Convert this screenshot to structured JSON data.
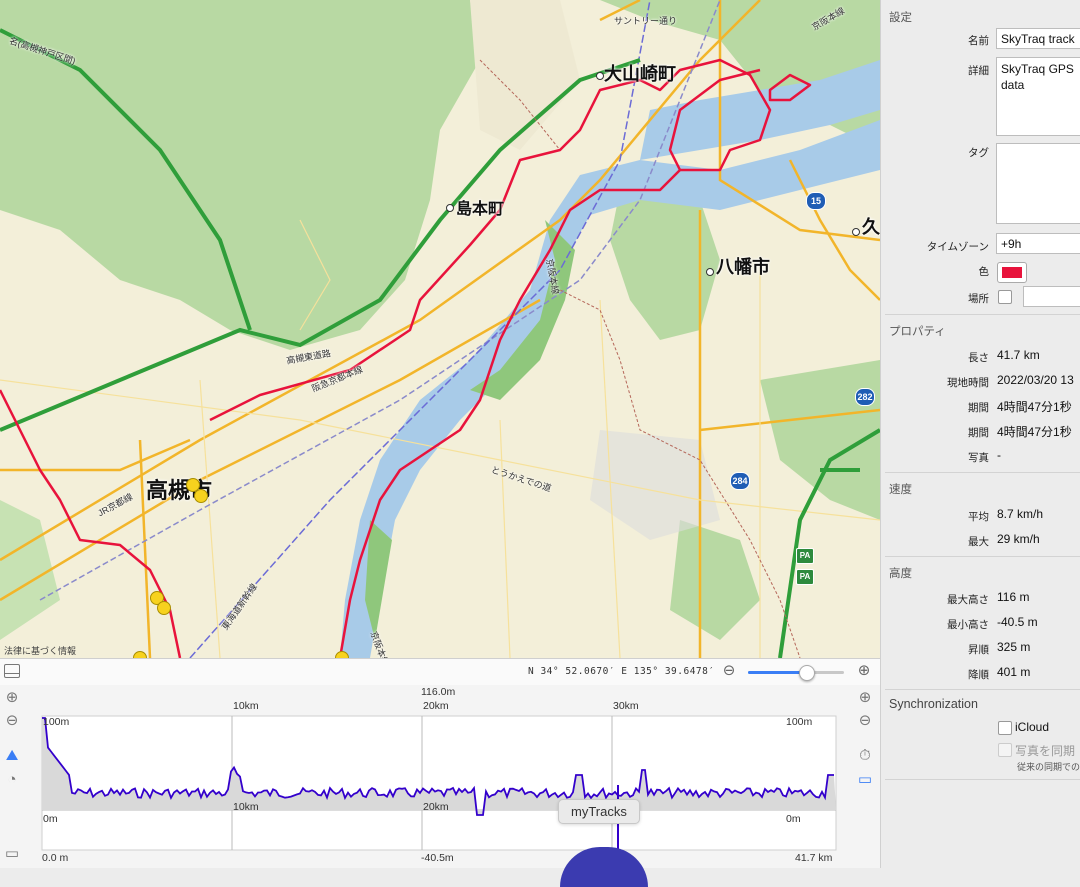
{
  "map": {
    "labels": {
      "oyamazaki": "大山崎町",
      "shimamoto": "島本町",
      "yawata": "八幡市",
      "takatsuki": "高槻市",
      "ku": "久",
      "suntory": "サントリー通り",
      "keihanhonsen": "京阪本線",
      "hankyu": "阪急京都本線",
      "takatsuki_higashi": "高槻東道路",
      "meishin": "名(高槻神戸区間)",
      "jr": "JR京都線",
      "keihan_west": "京阪本線",
      "toukaido": "とうかえでの道",
      "shinkansen": "東海道新幹線",
      "keihan_bottom": "京阪本線"
    },
    "shields": [
      "15",
      "282",
      "284"
    ],
    "pa": [
      "PA",
      "PA"
    ],
    "legal": "法律に基づく情報",
    "track_color": "#e8133c"
  },
  "mapbar": {
    "coordinates": "N 34° 52.0670′ E 135° 39.6478′",
    "zoom_out": "⊖",
    "zoom_in": "⊕",
    "zoom_level": 0.6
  },
  "elevation": {
    "top_center": "116.0m",
    "top_labels": [
      "10km",
      "20km",
      "30km"
    ],
    "left_top": "100m",
    "right_top": "100m",
    "left_bottom": "0m",
    "right_bottom": "0m",
    "mid_10": "10km",
    "mid_20": "20km",
    "x_start": "0.0 m",
    "x_min": "-40.5m",
    "x_end": "41.7 km",
    "tooltip": "myTracks"
  },
  "sidebar": {
    "settings_header": "設定",
    "name_label": "名前",
    "name_value": "SkyTraq track",
    "detail_label": "詳細",
    "detail_value_1": "SkyTraq GPS",
    "detail_value_2": "data",
    "tag_label": "タグ",
    "timezone_label": "タイムゾーン",
    "timezone_value": "+9h",
    "color_label": "色",
    "color_value": "#e8133c",
    "place_label": "場所",
    "properties_header": "プロパティ",
    "length_label": "長さ",
    "length_value": "41.7 km",
    "localtime_label": "現地時間",
    "localtime_value": "2022/03/20 13",
    "duration1_label": "期間",
    "duration1_value": "4時間47分1秒",
    "duration2_label": "期間",
    "duration2_value": "4時間47分1秒",
    "photo_label": "写真",
    "photo_value": "-",
    "speed_header": "速度",
    "avg_label": "平均",
    "avg_value": "8.7 km/h",
    "max_label": "最大",
    "max_value": "29 km/h",
    "altitude_header": "高度",
    "maxalt_label": "最大高さ",
    "maxalt_value": "116 m",
    "minalt_label": "最小高さ",
    "minalt_value": "-40.5 m",
    "ascent_label": "昇順",
    "ascent_value": "325 m",
    "descent_label": "降順",
    "descent_value": "401 m",
    "sync_header": "Synchronization",
    "icloud_label": "iCloud",
    "photo_sync_label": "写真を同期",
    "sync_note": "従来の同期でのみ"
  }
}
